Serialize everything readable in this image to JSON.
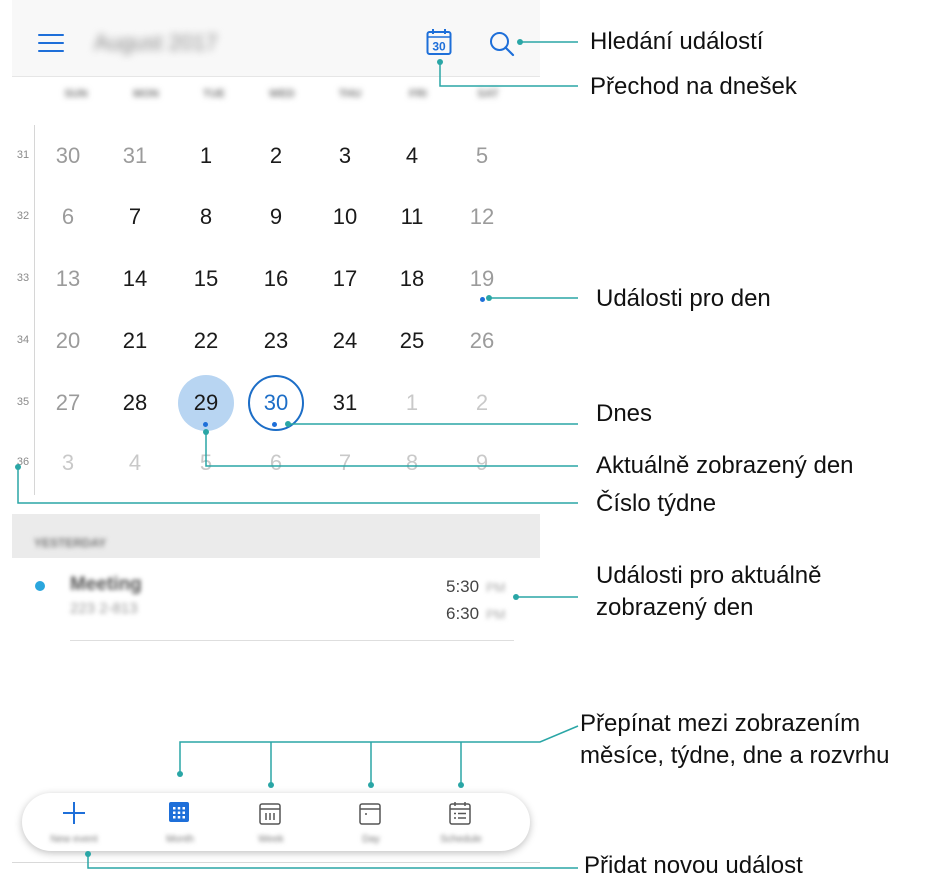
{
  "header": {
    "month_title": "August 2017",
    "menu_icon": "menu-icon",
    "today_icon": "calendar-today-icon",
    "today_icon_day": "30",
    "search_icon": "search-icon"
  },
  "weekday_labels": [
    "SUN",
    "MON",
    "TUE",
    "WED",
    "THU",
    "FRI",
    "SAT"
  ],
  "weeks": [
    {
      "number": "31",
      "days": [
        "30",
        "31",
        "1",
        "2",
        "3",
        "4",
        "5"
      ]
    },
    {
      "number": "32",
      "days": [
        "6",
        "7",
        "8",
        "9",
        "10",
        "11",
        "12"
      ]
    },
    {
      "number": "33",
      "days": [
        "13",
        "14",
        "15",
        "16",
        "17",
        "18",
        "19"
      ]
    },
    {
      "number": "34",
      "days": [
        "20",
        "21",
        "22",
        "23",
        "24",
        "25",
        "26"
      ]
    },
    {
      "number": "35",
      "days": [
        "27",
        "28",
        "29",
        "30",
        "31",
        "1",
        "2"
      ]
    },
    {
      "number": "36",
      "days": [
        "3",
        "4",
        "5",
        "6",
        "7",
        "8",
        "9"
      ]
    }
  ],
  "agenda": {
    "section_label": "YESTERDAY",
    "event": {
      "title": "Meeting",
      "location": "223 2-813",
      "start_time": "5:30",
      "start_ampm": "PM",
      "end_time": "6:30",
      "end_ampm": "PM"
    }
  },
  "bottom_bar": {
    "items": [
      {
        "label": "New event",
        "icon": "plus-icon"
      },
      {
        "label": "Month",
        "icon": "month-view-icon"
      },
      {
        "label": "Week",
        "icon": "week-view-icon"
      },
      {
        "label": "Day",
        "icon": "day-view-icon"
      },
      {
        "label": "Schedule",
        "icon": "schedule-view-icon"
      }
    ]
  },
  "annotations": {
    "search_events": "Hledání událostí",
    "go_to_today": "Přechod na dnešek",
    "events_for_day": "Události pro den",
    "today": "Dnes",
    "current_day": "Aktuálně zobrazený den",
    "week_number": "Číslo týdne",
    "current_day_events_line1": "Události pro aktuálně",
    "current_day_events_line2": "zobrazený den",
    "switch_views_line1": "Přepínat mezi zobrazením",
    "switch_views_line2": "měsíce, týdne, dne a rozvrhu",
    "add_event": "Přidat novou událost"
  },
  "colors": {
    "accent": "#1e6fd9",
    "selected_day_fill": "#b8d5f2",
    "today_ring": "#1d6ec7",
    "event_bullet": "#2aa6dd",
    "callout_line": "#2aa6a6"
  }
}
